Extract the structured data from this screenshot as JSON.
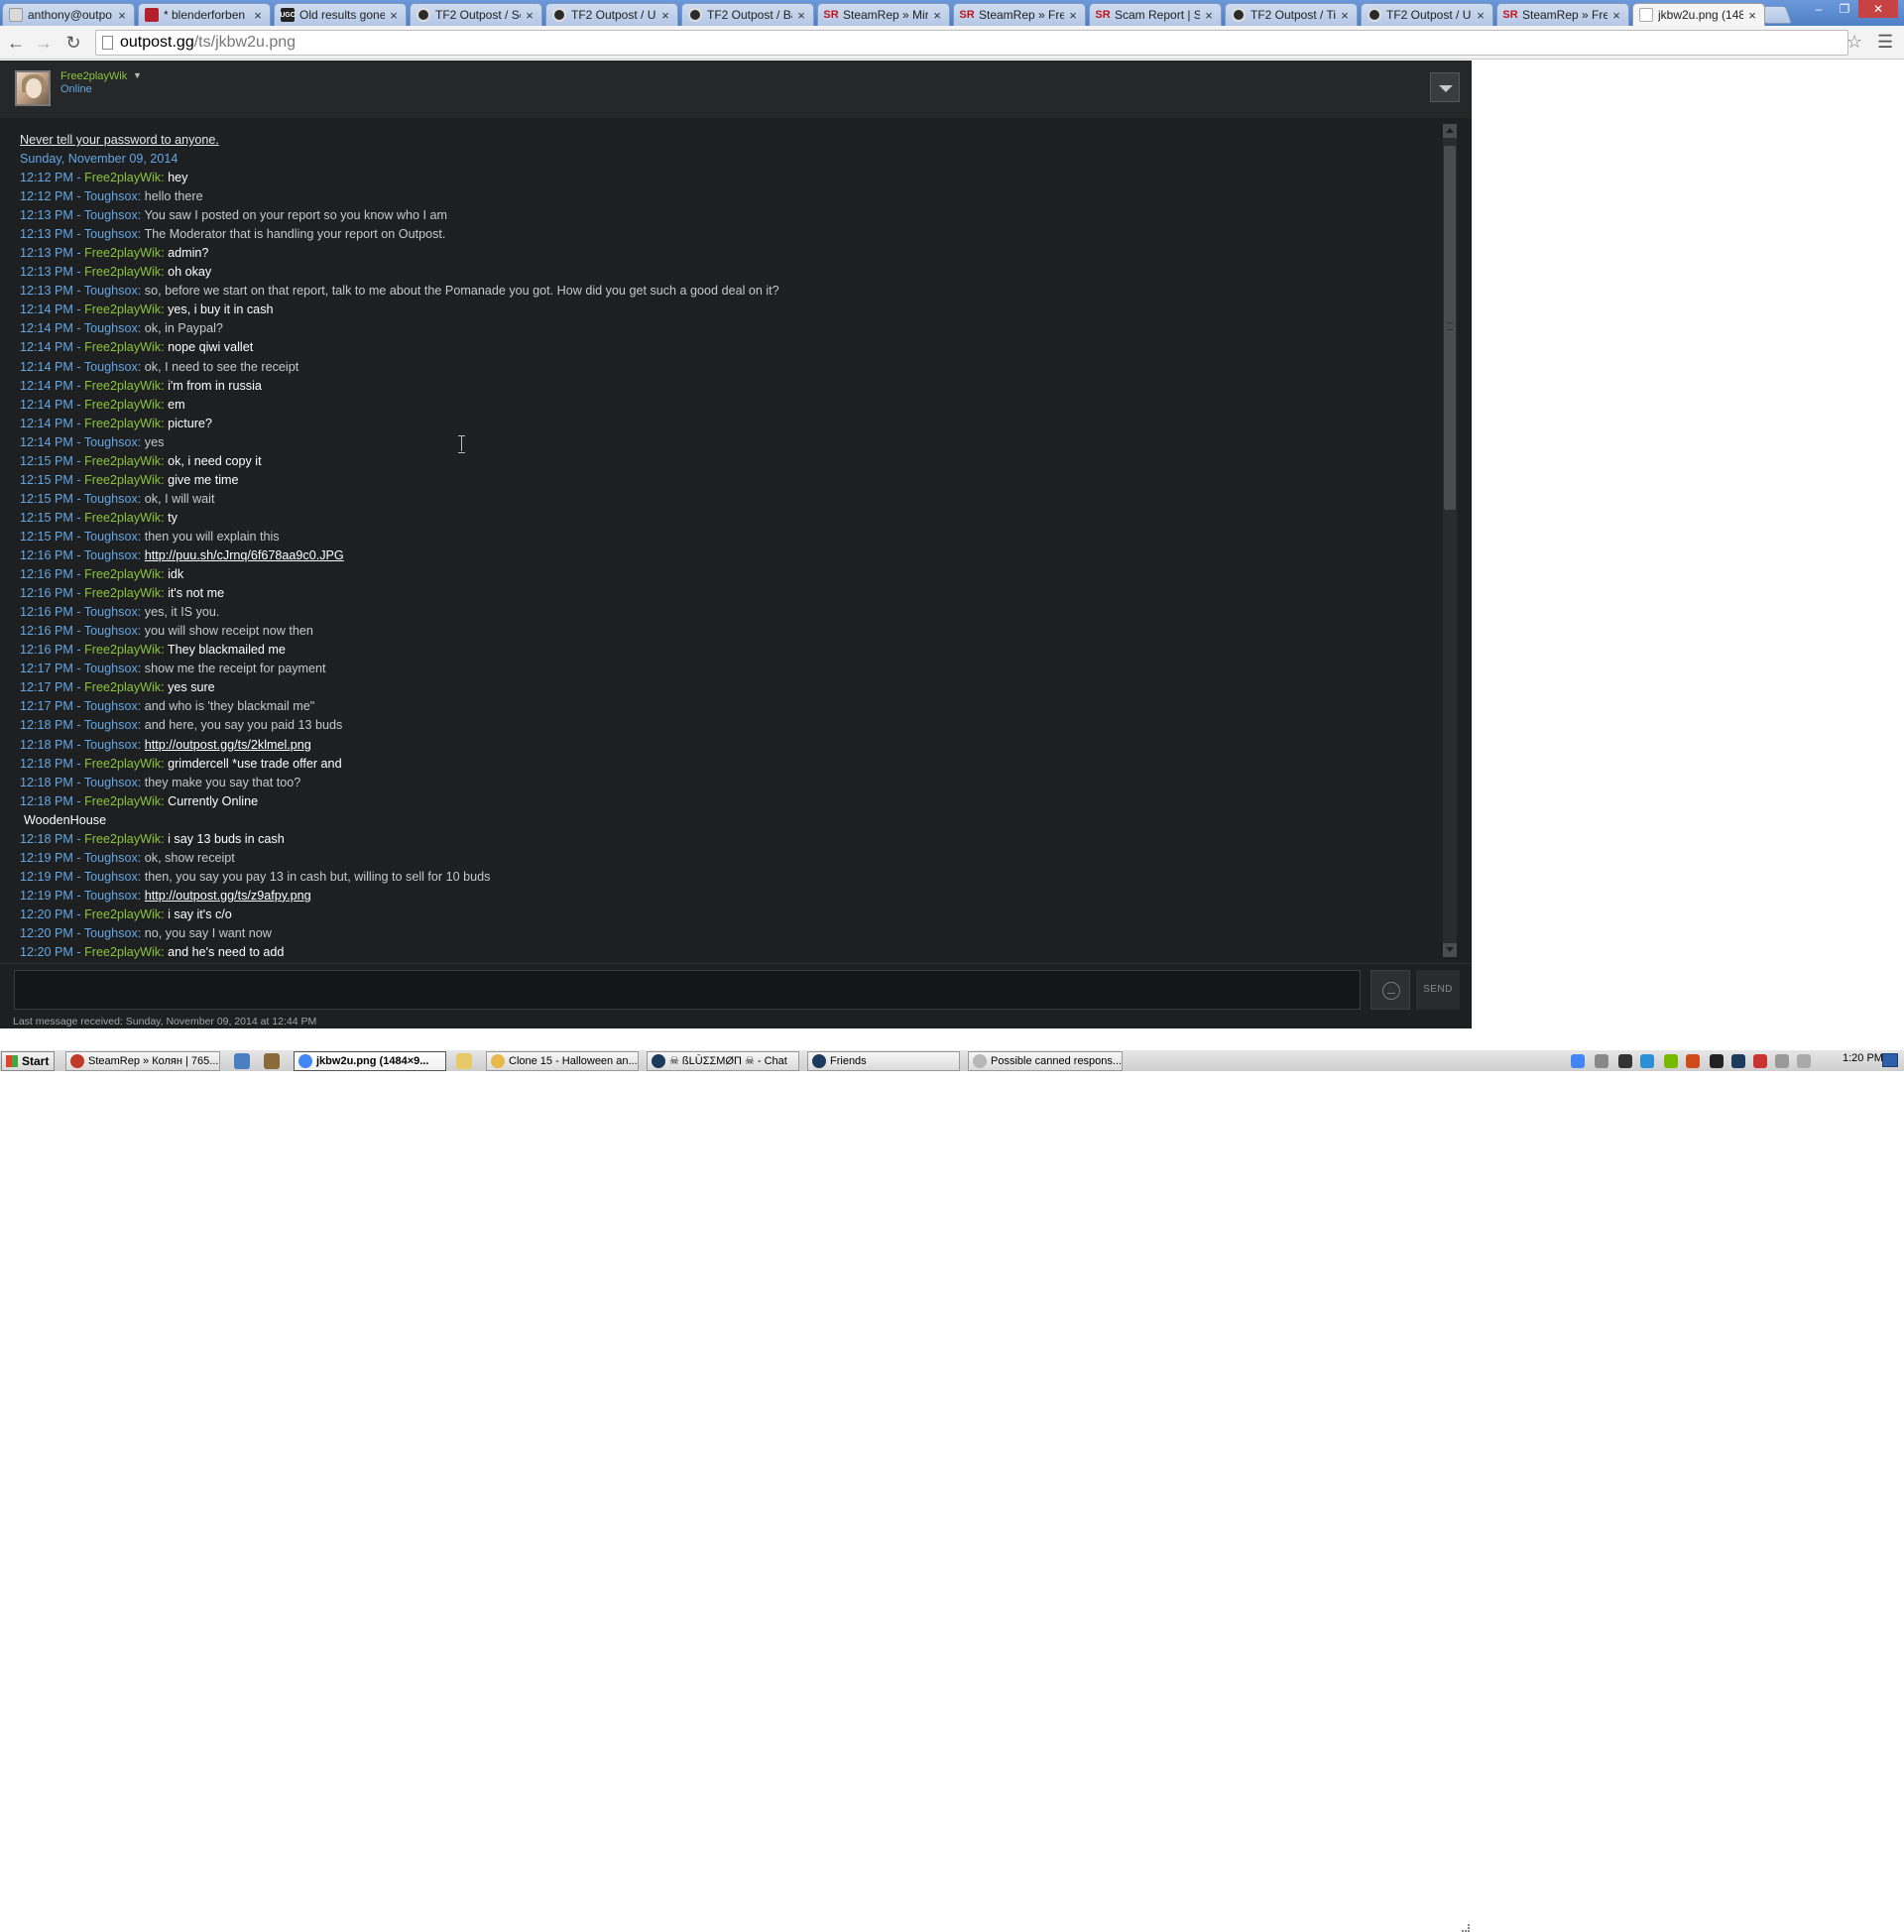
{
  "browser": {
    "tabs": [
      {
        "label": "anthony@outpo",
        "icon": "mail"
      },
      {
        "label": "* blenderforben",
        "icon": "trello"
      },
      {
        "label": "Old results gone",
        "icon": "ugc"
      },
      {
        "label": "TF2 Outpost / Sc",
        "icon": "op"
      },
      {
        "label": "TF2 Outpost / Us",
        "icon": "op"
      },
      {
        "label": "TF2 Outpost / Ba",
        "icon": "op"
      },
      {
        "label": "SteamRep » Mira",
        "icon": "sr"
      },
      {
        "label": "SteamRep » Free",
        "icon": "sr"
      },
      {
        "label": "Scam Report | St",
        "icon": "sr"
      },
      {
        "label": "TF2 Outpost / Ti",
        "icon": "op"
      },
      {
        "label": "TF2 Outpost / Us",
        "icon": "op"
      },
      {
        "label": "SteamRep » Free",
        "icon": "sr"
      },
      {
        "label": "jkbw2u.png (148",
        "icon": "img"
      }
    ],
    "ugc_favicon_text": "UGC",
    "sr_favicon_text": "SR",
    "url_host": "outpost.gg",
    "url_path": "/ts/jkbw2u.png"
  },
  "chat": {
    "username": "Free2playWik",
    "status": "Online",
    "warning": "Never tell your password to anyone.",
    "date": "Sunday, November 09, 2014",
    "lines": [
      {
        "time": "12:12 PM",
        "who": "Free2playWik",
        "text": "hey"
      },
      {
        "time": "12:12 PM",
        "who": "Toughsox",
        "text": "hello there"
      },
      {
        "time": "12:13 PM",
        "who": "Toughsox",
        "text": "You saw I posted on your report so you know who I am"
      },
      {
        "time": "12:13 PM",
        "who": "Toughsox",
        "text": "The Moderator that is handling your report on Outpost."
      },
      {
        "time": "12:13 PM",
        "who": "Free2playWik",
        "text": "admin?"
      },
      {
        "time": "12:13 PM",
        "who": "Free2playWik",
        "text": "oh okay"
      },
      {
        "time": "12:13 PM",
        "who": "Toughsox",
        "text": "so, before we start on that report, talk to me about the Pomanade you got. How did you get such a good deal on it?"
      },
      {
        "time": "12:14 PM",
        "who": "Free2playWik",
        "text": "yes, i buy it in cash"
      },
      {
        "time": "12:14 PM",
        "who": "Toughsox",
        "text": "ok, in Paypal?"
      },
      {
        "time": "12:14 PM",
        "who": "Free2playWik",
        "text": "nope qiwi vallet"
      },
      {
        "time": "12:14 PM",
        "who": "Toughsox",
        "text": "ok, I need to see the receipt"
      },
      {
        "time": "12:14 PM",
        "who": "Free2playWik",
        "text": "i'm from in russia"
      },
      {
        "time": "12:14 PM",
        "who": "Free2playWik",
        "text": "em"
      },
      {
        "time": "12:14 PM",
        "who": "Free2playWik",
        "text": "picture?"
      },
      {
        "time": "12:14 PM",
        "who": "Toughsox",
        "text": "yes"
      },
      {
        "time": "12:15 PM",
        "who": "Free2playWik",
        "text": "ok, i need copy it"
      },
      {
        "time": "12:15 PM",
        "who": "Free2playWik",
        "text": "give me time"
      },
      {
        "time": "12:15 PM",
        "who": "Toughsox",
        "text": "ok, I will wait"
      },
      {
        "time": "12:15 PM",
        "who": "Free2playWik",
        "text": "ty"
      },
      {
        "time": "12:15 PM",
        "who": "Toughsox",
        "text": "then you will explain this"
      },
      {
        "time": "12:16 PM",
        "who": "Toughsox",
        "text": "http://puu.sh/cJrnq/6f678aa9c0.JPG",
        "link": true
      },
      {
        "time": "12:16 PM",
        "who": "Free2playWik",
        "text": "idk"
      },
      {
        "time": "12:16 PM",
        "who": "Free2playWik",
        "text": "it's not me"
      },
      {
        "time": "12:16 PM",
        "who": "Toughsox",
        "text": "yes, it IS you."
      },
      {
        "time": "12:16 PM",
        "who": "Toughsox",
        "text": "you will show receipt now then"
      },
      {
        "time": "12:16 PM",
        "who": "Free2playWik",
        "text": "They blackmailed me"
      },
      {
        "time": "12:17 PM",
        "who": "Toughsox",
        "text": "show me the receipt for payment"
      },
      {
        "time": "12:17 PM",
        "who": "Free2playWik",
        "text": "yes sure"
      },
      {
        "time": "12:17 PM",
        "who": "Toughsox",
        "text": "and who is 'they blackmail me\""
      },
      {
        "time": "12:18 PM",
        "who": "Toughsox",
        "text": "and here, you say you paid 13 buds"
      },
      {
        "time": "12:18 PM",
        "who": "Toughsox",
        "text": "http://outpost.gg/ts/2klmel.png",
        "link": true
      },
      {
        "time": "12:18 PM",
        "who": "Free2playWik",
        "text": "grimdercell *use trade offer and"
      },
      {
        "time": "12:18 PM",
        "who": "Toughsox",
        "text": "they make you say that too?"
      },
      {
        "time": "12:18 PM",
        "who": "Free2playWik",
        "text": "Currently Online"
      },
      {
        "continuation": "WoodenHouse"
      },
      {
        "time": "12:18 PM",
        "who": "Free2playWik",
        "text": "i say 13 buds in cash"
      },
      {
        "time": "12:19 PM",
        "who": "Toughsox",
        "text": "ok, show receipt"
      },
      {
        "time": "12:19 PM",
        "who": "Toughsox",
        "text": "then, you say you pay 13 in cash but, willing to sell for 10 buds"
      },
      {
        "time": "12:19 PM",
        "who": "Toughsox",
        "text": "http://outpost.gg/ts/z9afpy.png",
        "link": true
      },
      {
        "time": "12:20 PM",
        "who": "Free2playWik",
        "text": "i say it's c/o"
      },
      {
        "time": "12:20 PM",
        "who": "Toughsox",
        "text": "no, you say I want now"
      },
      {
        "time": "12:20 PM",
        "who": "Free2playWik",
        "text": "and he's need to add"
      }
    ],
    "input_value": "",
    "send_label": "SEND",
    "last_received": "Last message received: Sunday, November 09, 2014 at 12:44 PM"
  },
  "taskbar": {
    "start_label": "Start",
    "buttons": [
      {
        "label": "SteamRep » Колян | 765...",
        "icon_color": "#c0392b"
      },
      {
        "label": "jkbw2u.png (1484×9...",
        "icon_color": "#4285f4",
        "active": true
      },
      {
        "label": "Clone 15 - Halloween an...",
        "icon_color": "#e9b84a"
      },
      {
        "label": "☠ ßLŪƩƩMØП ☠ - Chat",
        "icon_color": "#1b3a5c"
      },
      {
        "label": "Friends",
        "icon_color": "#1b3a5c"
      },
      {
        "label": "Possible canned respons...",
        "icon_color": "#b7b7b7"
      }
    ],
    "clock": "1:20 PM"
  }
}
